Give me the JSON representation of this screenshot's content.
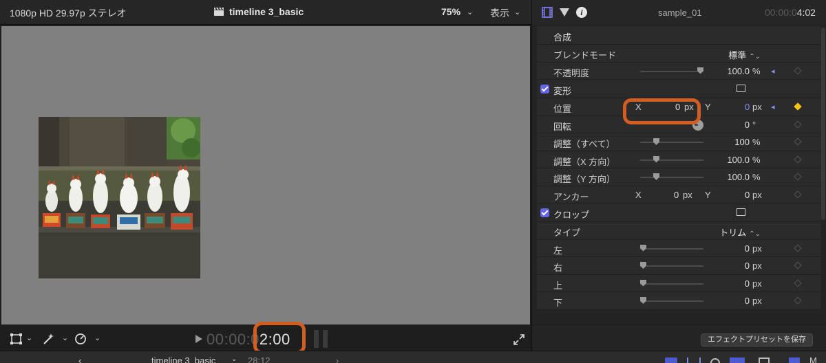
{
  "viewer": {
    "format": "1080p HD 29.97p ステレオ",
    "timeline_title": "timeline 3_basic",
    "zoom": "75%",
    "view_menu": "表示",
    "timecode_dim": "00:00:0",
    "timecode_active": "2:00"
  },
  "inspector": {
    "clip_name": "sample_01",
    "duration_dim": "00:00:0",
    "duration_active": "4:02",
    "composite": {
      "title": "合成",
      "blend_mode_label": "ブレンドモード",
      "blend_mode_value": "標準",
      "opacity_label": "不透明度",
      "opacity_value": "100.0",
      "opacity_unit": "%",
      "opacity_level": 1.0
    },
    "transform": {
      "title": "変形",
      "position_label": "位置",
      "position_x_axis": "X",
      "position_x": "0",
      "position_x_unit": "px",
      "position_y_axis": "Y",
      "position_y": "0",
      "position_y_unit": "px",
      "rotation_label": "回転",
      "rotation_value": "0",
      "rotation_unit": "°",
      "scale_all_label": "調整（すべて）",
      "scale_all_value": "100",
      "scale_all_unit": "%",
      "scale_x_label": "調整（X 方向）",
      "scale_x_value": "100.0",
      "scale_x_unit": "%",
      "scale_y_label": "調整（Y 方向）",
      "scale_y_value": "100.0",
      "scale_y_unit": "%",
      "anchor_label": "アンカー",
      "anchor_x_axis": "X",
      "anchor_x": "0",
      "anchor_x_unit": "px",
      "anchor_y_axis": "Y",
      "anchor_y": "0",
      "anchor_y_unit": "px"
    },
    "crop": {
      "title": "クロップ",
      "type_label": "タイプ",
      "type_value": "トリム",
      "left_label": "左",
      "left_value": "0",
      "right_label": "右",
      "right_value": "0",
      "top_label": "上",
      "top_value": "0",
      "bottom_label": "下",
      "bottom_value": "0",
      "unit": "px"
    },
    "save_preset_label": "エフェクトプリセットを保存"
  },
  "timeline_bar": {
    "back": "‹",
    "title": "timeline 3_basic",
    "duration": "28:12",
    "forward": "›"
  },
  "colors": {
    "accent": "#6464e6",
    "highlight": "#d35e23",
    "keyframe_active": "#f2c318"
  }
}
